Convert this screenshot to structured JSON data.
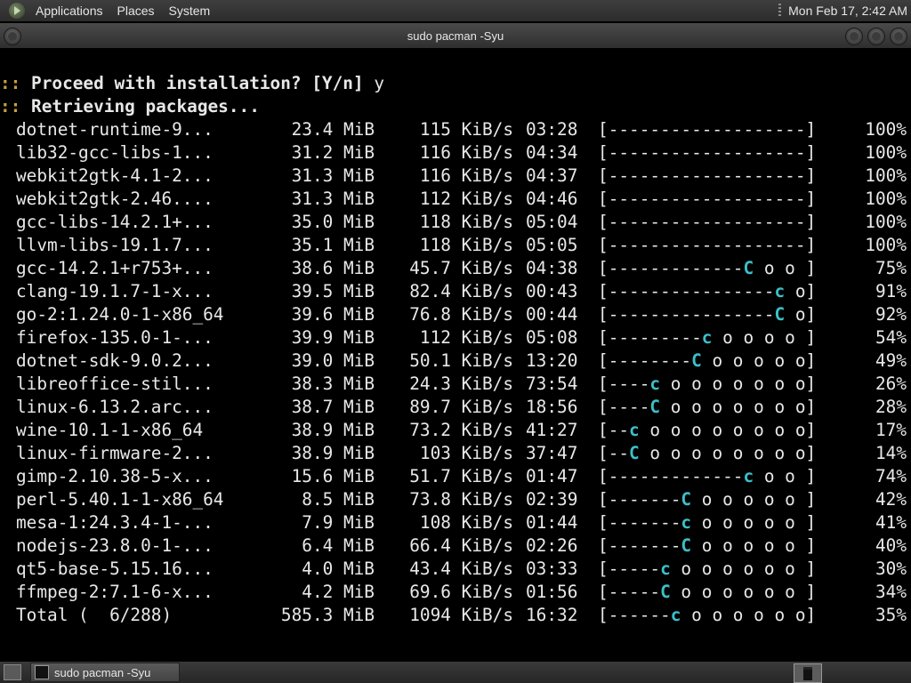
{
  "top_panel": {
    "menus": [
      "Applications",
      "Places",
      "System"
    ],
    "clock": "Mon Feb 17,  2:42 AM"
  },
  "window": {
    "title": "sudo pacman -Syu"
  },
  "terminal": {
    "prompt_marker": "::",
    "lines": [
      {
        "text": "Proceed with installation? [Y/n]",
        "input": "y"
      },
      {
        "text": "Retrieving packages..."
      }
    ],
    "downloads": [
      {
        "name": "dotnet-runtime-9...",
        "size": "23.4 MiB",
        "rate": "115 KiB/s",
        "eta": "03:28",
        "percent": 100,
        "pct_label": "100%"
      },
      {
        "name": "lib32-gcc-libs-1...",
        "size": "31.2 MiB",
        "rate": "116 KiB/s",
        "eta": "04:34",
        "percent": 100,
        "pct_label": "100%"
      },
      {
        "name": "webkit2gtk-4.1-2...",
        "size": "31.3 MiB",
        "rate": "116 KiB/s",
        "eta": "04:37",
        "percent": 100,
        "pct_label": "100%"
      },
      {
        "name": "webkit2gtk-2.46....",
        "size": "31.3 MiB",
        "rate": "112 KiB/s",
        "eta": "04:46",
        "percent": 100,
        "pct_label": "100%"
      },
      {
        "name": "gcc-libs-14.2.1+...",
        "size": "35.0 MiB",
        "rate": "118 KiB/s",
        "eta": "05:04",
        "percent": 100,
        "pct_label": "100%"
      },
      {
        "name": "llvm-libs-19.1.7...",
        "size": "35.1 MiB",
        "rate": "118 KiB/s",
        "eta": "05:05",
        "percent": 100,
        "pct_label": "100%"
      },
      {
        "name": "gcc-14.2.1+r753+...",
        "size": "38.6 MiB",
        "rate": "45.7 KiB/s",
        "eta": "04:38",
        "percent": 75,
        "pct_label": "75%"
      },
      {
        "name": "clang-19.1.7-1-x...",
        "size": "39.5 MiB",
        "rate": "82.4 KiB/s",
        "eta": "00:43",
        "percent": 91,
        "pct_label": "91%"
      },
      {
        "name": "go-2:1.24.0-1-x86_64",
        "size": "39.6 MiB",
        "rate": "76.8 KiB/s",
        "eta": "00:44",
        "percent": 92,
        "pct_label": "92%"
      },
      {
        "name": "firefox-135.0-1-...",
        "size": "39.9 MiB",
        "rate": "112 KiB/s",
        "eta": "05:08",
        "percent": 54,
        "pct_label": "54%"
      },
      {
        "name": "dotnet-sdk-9.0.2...",
        "size": "39.0 MiB",
        "rate": "50.1 KiB/s",
        "eta": "13:20",
        "percent": 49,
        "pct_label": "49%"
      },
      {
        "name": "libreoffice-stil...",
        "size": "38.3 MiB",
        "rate": "24.3 KiB/s",
        "eta": "73:54",
        "percent": 26,
        "pct_label": "26%"
      },
      {
        "name": "linux-6.13.2.arc...",
        "size": "38.7 MiB",
        "rate": "89.7 KiB/s",
        "eta": "18:56",
        "percent": 28,
        "pct_label": "28%"
      },
      {
        "name": "wine-10.1-1-x86_64",
        "size": "38.9 MiB",
        "rate": "73.2 KiB/s",
        "eta": "41:27",
        "percent": 17,
        "pct_label": "17%"
      },
      {
        "name": "linux-firmware-2...",
        "size": "38.9 MiB",
        "rate": "103 KiB/s",
        "eta": "37:47",
        "percent": 14,
        "pct_label": "14%"
      },
      {
        "name": "gimp-2.10.38-5-x...",
        "size": "15.6 MiB",
        "rate": "51.7 KiB/s",
        "eta": "01:47",
        "percent": 74,
        "pct_label": "74%"
      },
      {
        "name": "perl-5.40.1-1-x86_64",
        "size": "8.5 MiB",
        "rate": "73.8 KiB/s",
        "eta": "02:39",
        "percent": 42,
        "pct_label": "42%"
      },
      {
        "name": "mesa-1:24.3.4-1-...",
        "size": "7.9 MiB",
        "rate": "108 KiB/s",
        "eta": "01:44",
        "percent": 41,
        "pct_label": "41%"
      },
      {
        "name": "nodejs-23.8.0-1-...",
        "size": "6.4 MiB",
        "rate": "66.4 KiB/s",
        "eta": "02:26",
        "percent": 40,
        "pct_label": "40%"
      },
      {
        "name": "qt5-base-5.15.16...",
        "size": "4.0 MiB",
        "rate": "43.4 KiB/s",
        "eta": "03:33",
        "percent": 30,
        "pct_label": "30%"
      },
      {
        "name": "ffmpeg-2:7.1-6-x...",
        "size": "4.2 MiB",
        "rate": "69.6 KiB/s",
        "eta": "01:56",
        "percent": 34,
        "pct_label": "34%"
      }
    ],
    "total": {
      "name": "Total (  6/288)",
      "size": "585.3 MiB",
      "rate": "1094 KiB/s",
      "eta": "16:32",
      "percent": 35,
      "pct_label": "35%"
    }
  },
  "taskbar": {
    "task_label": "sudo pacman -Syu"
  },
  "colors": {
    "pacman": "#3cc0c8",
    "prompt_marker": "#c8a040",
    "terminal_bg": "#000000",
    "terminal_fg": "#e8e8e8"
  }
}
